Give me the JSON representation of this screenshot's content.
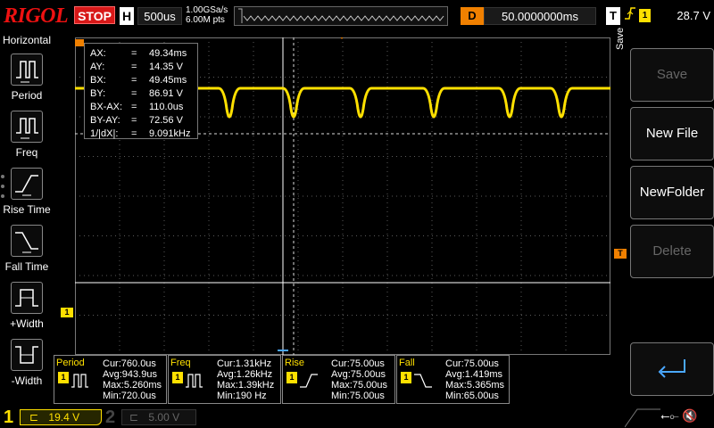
{
  "brand": "RIGOL",
  "run_state": "STOP",
  "timebase": {
    "label": "H",
    "value": "500us"
  },
  "sampling": {
    "rate": "1.00GSa/s",
    "points": "6.00M pts"
  },
  "delay": {
    "label": "D",
    "value": "50.0000000ms"
  },
  "trigger": {
    "label": "T",
    "icon": "rising-edge-icon",
    "channel": "1",
    "level": "28.7 V"
  },
  "left_menu": {
    "title": "Horizontal",
    "items": [
      {
        "label": "Period",
        "icon": "period-icon"
      },
      {
        "label": "Freq",
        "icon": "frequency-icon"
      },
      {
        "label": "Rise Time",
        "icon": "rise-time-icon"
      },
      {
        "label": "Fall Time",
        "icon": "fall-time-icon"
      },
      {
        "label": "+Width",
        "icon": "positive-width-icon"
      },
      {
        "label": "-Width",
        "icon": "negative-width-icon"
      }
    ]
  },
  "cursors": [
    {
      "key": "AX:",
      "value": "49.34ms"
    },
    {
      "key": "AY:",
      "value": "14.35 V"
    },
    {
      "key": "BX:",
      "value": "49.45ms"
    },
    {
      "key": "BY:",
      "value": "86.91 V"
    },
    {
      "key": "BX-AX:",
      "value": "110.0us"
    },
    {
      "key": "BY-AY:",
      "value": "72.56 V"
    },
    {
      "key": "1/|dX|:",
      "value": "9.091kHz"
    }
  ],
  "right_menu": {
    "tab": "Save",
    "buttons": [
      {
        "label": "Save",
        "enabled": false
      },
      {
        "label": "New File",
        "enabled": true
      },
      {
        "label": "NewFolder",
        "enabled": true
      },
      {
        "label": "Delete",
        "enabled": false
      }
    ],
    "return_icon": "return-arrow-icon"
  },
  "measurements": [
    {
      "name": "Period",
      "ch": "1",
      "cur": "Cur:760.0us",
      "avg": "Avg:943.9us",
      "max": "Max:5.260ms",
      "min": "Min:720.0us"
    },
    {
      "name": "Freq",
      "ch": "1",
      "cur": "Cur:1.31kHz",
      "avg": "Avg:1.26kHz",
      "max": "Max:1.39kHz",
      "min": "Min:190 Hz"
    },
    {
      "name": "Rise",
      "ch": "1",
      "cur": "Cur:75.00us",
      "avg": "Avg:75.00us",
      "max": "Max:75.00us",
      "min": "Min:75.00us"
    },
    {
      "name": "Fall",
      "ch": "1",
      "cur": "Cur:75.00us",
      "avg": "Avg:1.419ms",
      "max": "Max:5.365ms",
      "min": "Min:65.00us"
    }
  ],
  "channels": [
    {
      "num": "1",
      "scale": "19.4 V"
    },
    {
      "num": "2",
      "scale": "5.00 V"
    }
  ],
  "markers": {
    "ch1": "1",
    "trigger_level": "T"
  },
  "colors": {
    "ch1": "#ffe000",
    "accent": "#f08000",
    "stop": "#d81818",
    "grid": "#5a5a5a"
  }
}
